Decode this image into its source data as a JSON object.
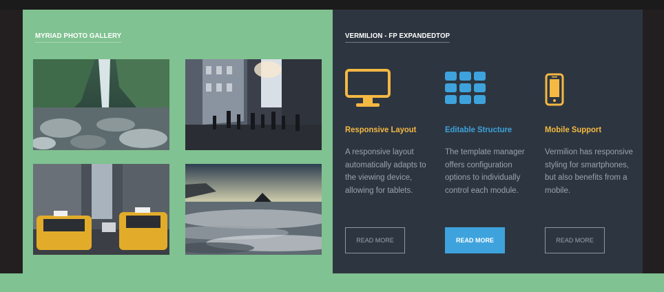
{
  "gallery": {
    "title": "MYRIAD PHOTO GALLERY",
    "photos": [
      {
        "subject": "waterfall-canyon"
      },
      {
        "subject": "city-street-crowd"
      },
      {
        "subject": "yellow-taxis"
      },
      {
        "subject": "rocky-sea-shore"
      }
    ]
  },
  "features": {
    "title": "VERMILION - FP EXPANDEDTOP",
    "items": [
      {
        "icon": "monitor-icon",
        "heading": "Responsive Layout",
        "description": "A responsive layout automatically adapts to the viewing device, allowing for tablets.",
        "button": "READ MORE",
        "color": "#f5b843"
      },
      {
        "icon": "grid-icon",
        "heading": "Editable Structure",
        "description": "The template manager offers configuration options to individually control each module.",
        "button": "READ MORE",
        "color": "#3ea3dc"
      },
      {
        "icon": "phone-icon",
        "heading": "Mobile Support",
        "description": "Vermilion has responsive styling for smartphones, but also benefits from a mobile.",
        "button": "READ MORE",
        "color": "#f5b843"
      }
    ]
  },
  "colors": {
    "green": "#80c291",
    "dark_panel": "#2d3640",
    "accent_orange": "#f5b843",
    "accent_blue": "#3ea3dc"
  }
}
